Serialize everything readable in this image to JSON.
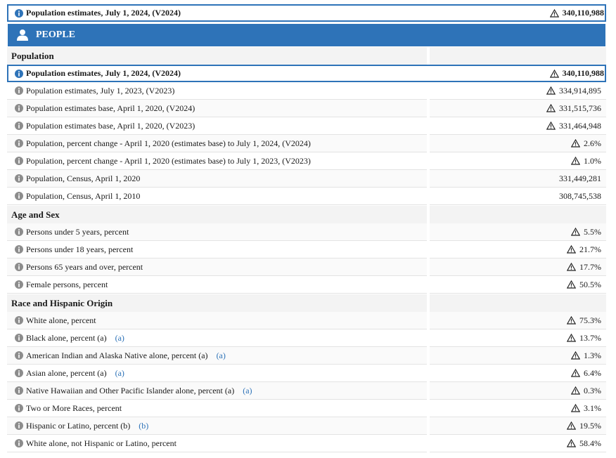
{
  "top_fact": {
    "label": "Population estimates, July 1, 2024, (V2024)",
    "value": "340,110,988"
  },
  "section_header": {
    "title": "PEOPLE",
    "icon": "person-icon"
  },
  "groups": [
    {
      "title": "Population",
      "rows": [
        {
          "label": "Population estimates, July 1, 2024, (V2024)",
          "value": "340,110,988",
          "warn": true,
          "highlight": true
        },
        {
          "label": "Population estimates, July 1, 2023, (V2023)",
          "value": "334,914,895",
          "warn": true
        },
        {
          "label": "Population estimates base, April 1, 2020, (V2024)",
          "value": "331,515,736",
          "warn": true
        },
        {
          "label": "Population estimates base, April 1, 2020, (V2023)",
          "value": "331,464,948",
          "warn": true
        },
        {
          "label": "Population, percent change - April 1, 2020 (estimates base) to July 1, 2024, (V2024)",
          "value": "2.6%",
          "warn": true
        },
        {
          "label": "Population, percent change - April 1, 2020 (estimates base) to July 1, 2023, (V2023)",
          "value": "1.0%",
          "warn": true
        },
        {
          "label": "Population, Census, April 1, 2020",
          "value": "331,449,281",
          "warn": false
        },
        {
          "label": "Population, Census, April 1, 2010",
          "value": "308,745,538",
          "warn": false
        }
      ]
    },
    {
      "title": "Age and Sex",
      "rows": [
        {
          "label": "Persons under 5 years, percent",
          "value": "5.5%",
          "warn": true
        },
        {
          "label": "Persons under 18 years, percent",
          "value": "21.7%",
          "warn": true
        },
        {
          "label": "Persons 65 years and over, percent",
          "value": "17.7%",
          "warn": true
        },
        {
          "label": "Female persons, percent",
          "value": "50.5%",
          "warn": true
        }
      ]
    },
    {
      "title": "Race and Hispanic Origin",
      "rows": [
        {
          "label": "White alone, percent",
          "value": "75.3%",
          "warn": true
        },
        {
          "label": "Black alone, percent (a)",
          "footnote": "(a)",
          "value": "13.7%",
          "warn": true
        },
        {
          "label": "American Indian and Alaska Native alone, percent (a)",
          "footnote": "(a)",
          "value": "1.3%",
          "warn": true
        },
        {
          "label": "Asian alone, percent (a)",
          "footnote": "(a)",
          "value": "6.4%",
          "warn": true
        },
        {
          "label": "Native Hawaiian and Other Pacific Islander alone, percent (a)",
          "footnote": "(a)",
          "value": "0.3%",
          "warn": true
        },
        {
          "label": "Two or More Races, percent",
          "value": "3.1%",
          "warn": true
        },
        {
          "label": "Hispanic or Latino, percent (b)",
          "footnote": "(b)",
          "value": "19.5%",
          "warn": true
        },
        {
          "label": "White alone, not Hispanic or Latino, percent",
          "value": "58.4%",
          "warn": true
        }
      ]
    }
  ],
  "icons": {
    "info": "info-icon",
    "warning": "warning-triangle-icon"
  },
  "colors": {
    "accent": "#2e73b8",
    "section_bg": "#f3f3f3",
    "info_gray": "#8c8c8c"
  }
}
